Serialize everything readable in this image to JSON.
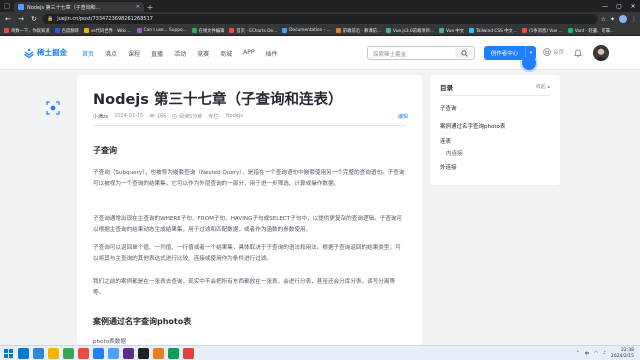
{
  "browser": {
    "tab_title": "Nodejs 第三十七章（子查询和...",
    "url": "juejin.cn/post/7334723698261268517",
    "bookmarks": [
      {
        "label": "鸡数一下，你就知道",
        "color": "#e84c3d"
      },
      {
        "label": "百度翻译",
        "color": "#2b5bd7"
      },
      {
        "label": "vs代码世界 - Wiki ...",
        "color": "#f4b400"
      },
      {
        "label": "Can I use... Suppo...",
        "color": "#9b59b6"
      },
      {
        "label": "在线文件编辑",
        "color": "#34a853"
      },
      {
        "label": "首页 · ECharts De...",
        "color": "#e84c3d"
      },
      {
        "label": "Documentation - ...",
        "color": "#4ea1ff"
      },
      {
        "label": "前端前沿 · 慕课前...",
        "color": "#e67e22"
      },
      {
        "label": "Vue.js3.0前端项目...",
        "color": "#41b883"
      },
      {
        "label": "Vue 中文",
        "color": "#41b883"
      },
      {
        "label": "Tailwind CSS 中文...",
        "color": "#38bdf8"
      },
      {
        "label": "(1条消息) Vue ...",
        "color": "#e84c3d"
      },
      {
        "label": "Vant · 轻量、可靠...",
        "color": "#07c160"
      }
    ]
  },
  "header": {
    "logo_text": "稀土掘金",
    "nav": [
      "首页",
      "沸点",
      "课程",
      "直播",
      "活动",
      "竞赛",
      "商城",
      "APP",
      "插件"
    ],
    "nav_active_index": 0,
    "search_placeholder": "探索稀土掘金",
    "create_label": "创作者中心",
    "vip_label": "会员"
  },
  "article": {
    "title": "Nodejs 第三十七章（子查询和连表）",
    "author": "小满zs",
    "date": "2024-02-15",
    "views": "166",
    "read_time": "阅读5分钟",
    "column": "专栏:",
    "column_name": "Nodejs",
    "edit_label": "编辑",
    "sections": [
      {
        "heading": "子查询",
        "paragraphs": [
          "子查询（Subquery），也被称为嵌套查询（Nested Query），是指在一个查询语句中嵌套使用另一个完整的查询语句。子查询可以被视为一个查询的结果集，它可以作为外层查询的一部分，用于进一步筛选、计算或操作数据。",
          "子查询通常出现在主查询的WHERE子句、FROM子句、HAVING子句或SELECT子句中，以提供更复杂的查询逻辑。子查询可以根据主查询的结果动态生成结果集，用于过滤和匹配数据，或者作为函数的参数使用。",
          "子查询可以返回单个值、一列值、一行值或者一个结果集，具体取决于子查询的语法和用法。根据子查询返回的结果类型，可以将其与主查询的其他表达式进行比较、连接或使用作为条件进行过滤。",
          "我们之前的案例都是在一张表去查询，现实中不会把所有东西都放在一张表，会进行分表，甚至还会分库分表，读写分离等等。"
        ]
      },
      {
        "heading": "案例通过名字查询photo表",
        "paragraphs": [
          "photo表数据"
        ]
      }
    ]
  },
  "toc": {
    "title": "目录",
    "collapse_label": "收起 ▴",
    "items": [
      {
        "label": "子查询",
        "level": 1
      },
      {
        "label": "案例通过名字查询photo表",
        "level": 1
      },
      {
        "label": "连表",
        "level": 1
      },
      {
        "label": "内连接",
        "level": 2
      },
      {
        "label": "外连接",
        "level": 1
      }
    ]
  },
  "taskbar": {
    "time": "22:38",
    "date": "2024/2/15",
    "ime": "中",
    "apps": [
      "#0078d4",
      "#2b88d8",
      "#f4b400",
      "#34a853",
      "#e84c3d",
      "#1e80ff",
      "#4ea1ff",
      "#5c2d91",
      "#202124",
      "#e67e22",
      "#0f9d58",
      "#db4437"
    ]
  }
}
